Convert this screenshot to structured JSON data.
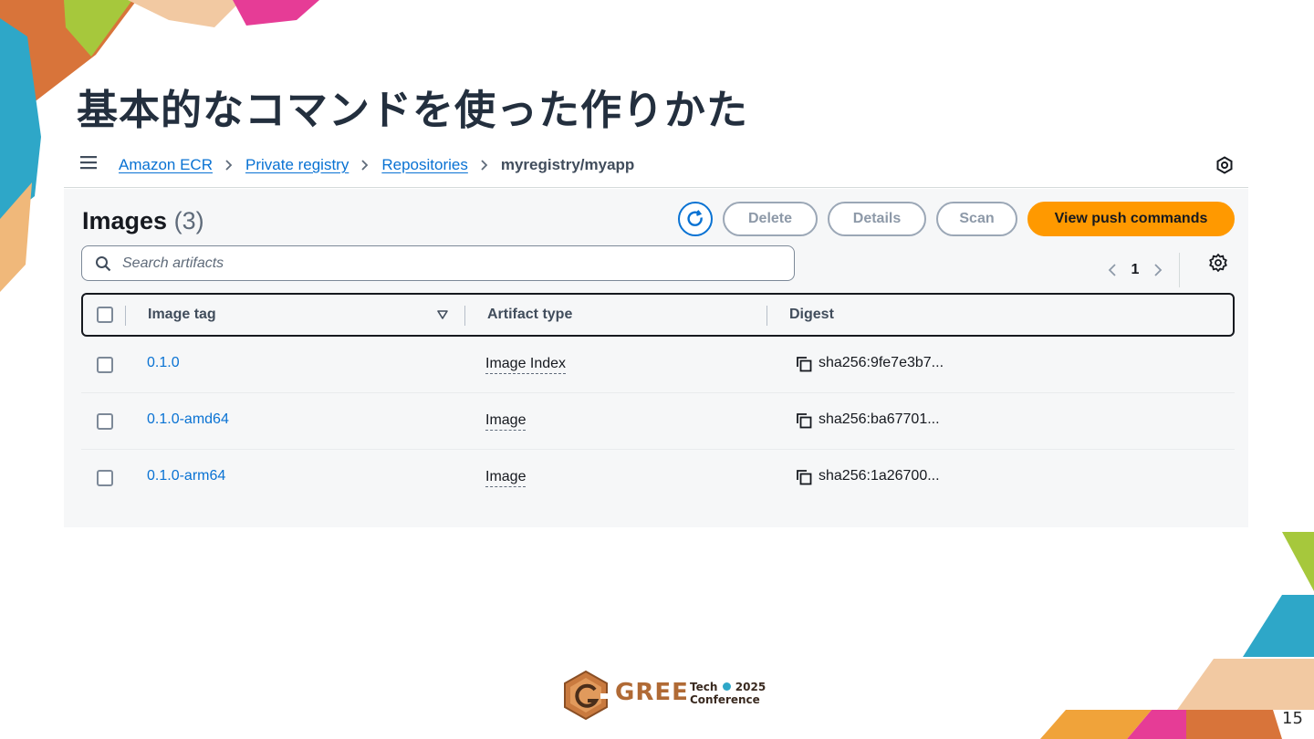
{
  "slide": {
    "title": "基本的なコマンドを使った作りかた",
    "page_number": "15"
  },
  "breadcrumbs": {
    "items": [
      "Amazon ECR",
      "Private registry",
      "Repositories"
    ],
    "current": "myregistry/myapp"
  },
  "images": {
    "heading": "Images",
    "count": "(3)"
  },
  "actions": {
    "delete_label": "Delete",
    "details_label": "Details",
    "scan_label": "Scan",
    "push_label": "View push commands"
  },
  "search": {
    "placeholder": "Search artifacts",
    "value": ""
  },
  "pagination": {
    "current_page": "1"
  },
  "table": {
    "columns": [
      "Image tag",
      "Artifact type",
      "Digest"
    ],
    "rows": [
      {
        "tag": "0.1.0",
        "artifact_type": "Image Index",
        "digest": "sha256:9fe7e3b7..."
      },
      {
        "tag": "0.1.0-amd64",
        "artifact_type": "Image",
        "digest": "sha256:ba67701..."
      },
      {
        "tag": "0.1.0-arm64",
        "artifact_type": "Image",
        "digest": "sha256:1a26700..."
      }
    ]
  },
  "logo": {
    "word": "GREE",
    "tech": "Tech",
    "year": "2025",
    "conference": "Conference"
  },
  "colors": {
    "link": "#0972d3",
    "primary_button": "#ff9900",
    "title": "#232f3e"
  }
}
